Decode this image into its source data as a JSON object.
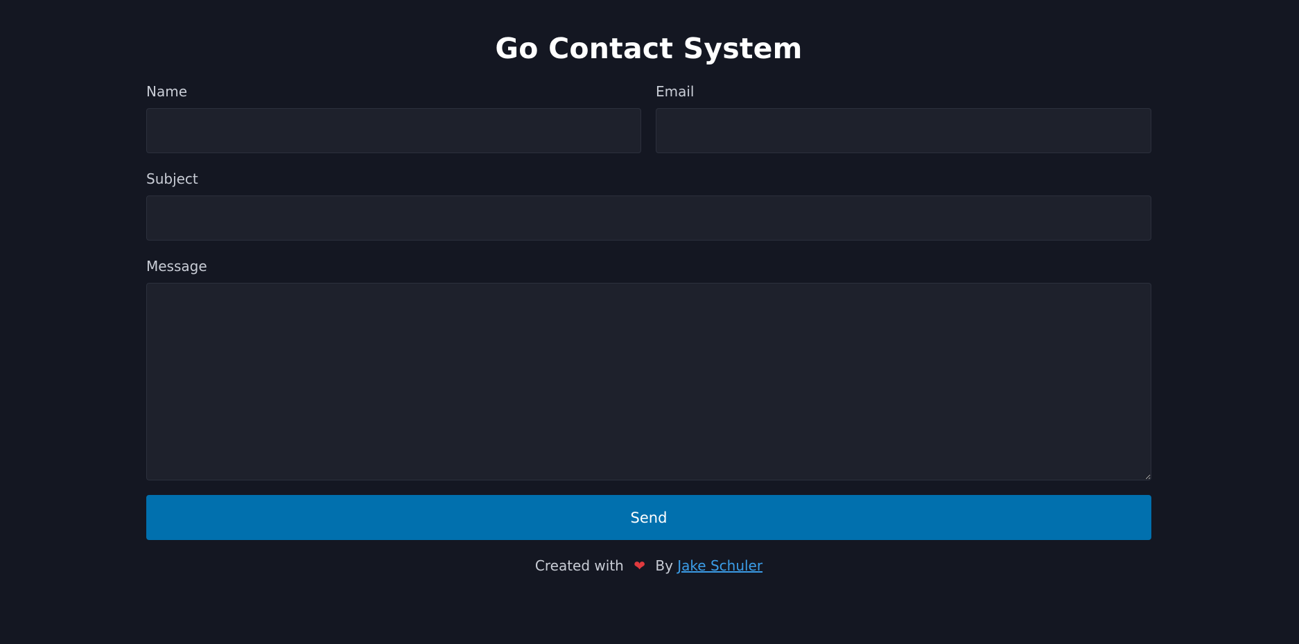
{
  "page": {
    "title": "Go Contact System"
  },
  "form": {
    "name_label": "Name",
    "name_value": "",
    "email_label": "Email",
    "email_value": "",
    "subject_label": "Subject",
    "subject_value": "",
    "message_label": "Message",
    "message_value": "",
    "send_label": "Send"
  },
  "footer": {
    "created_text": "Created with",
    "heart_icon": "heart-icon",
    "heart_glyph": "❤",
    "by_text": "By",
    "author_link": "Jake Schuler"
  },
  "colors": {
    "background": "#141722",
    "field_background": "#1e212c",
    "accent": "#0170ae",
    "link": "#3b9de8",
    "heart": "#e03a3e"
  }
}
